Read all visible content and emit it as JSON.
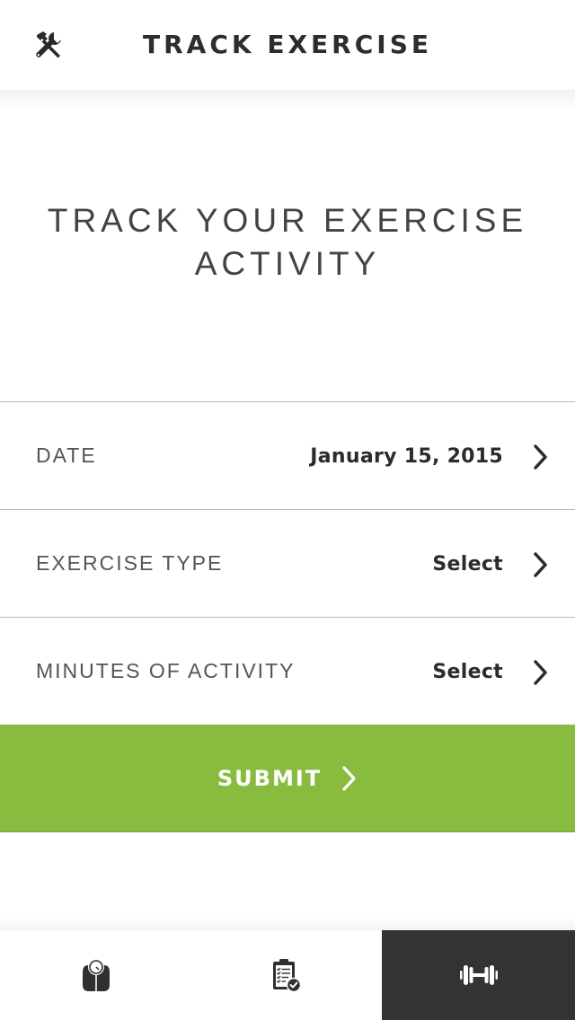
{
  "header": {
    "title": "TRACK EXERCISE",
    "left_icon": "tools-icon"
  },
  "hero": {
    "line1": "TRACK YOUR EXERCISE",
    "line2": "ACTIVITY"
  },
  "form": {
    "rows": [
      {
        "label": "DATE",
        "value": "January 15, 2015",
        "icon": "chevron-right-icon"
      },
      {
        "label": "EXERCISE TYPE",
        "value": "Select",
        "icon": "chevron-right-icon"
      },
      {
        "label": "MINUTES OF ACTIVITY",
        "value": "Select",
        "icon": "chevron-right-icon"
      }
    ]
  },
  "submit": {
    "label": "SUBMIT",
    "icon": "chevron-right-icon",
    "color": "#88bb3e"
  },
  "tabbar": {
    "tabs": [
      {
        "name": "weight",
        "icon": "scale-icon",
        "active": false
      },
      {
        "name": "checklist",
        "icon": "clipboard-check-icon",
        "active": false
      },
      {
        "name": "exercise",
        "icon": "dumbbell-icon",
        "active": true
      }
    ],
    "active_color": "#333333"
  }
}
